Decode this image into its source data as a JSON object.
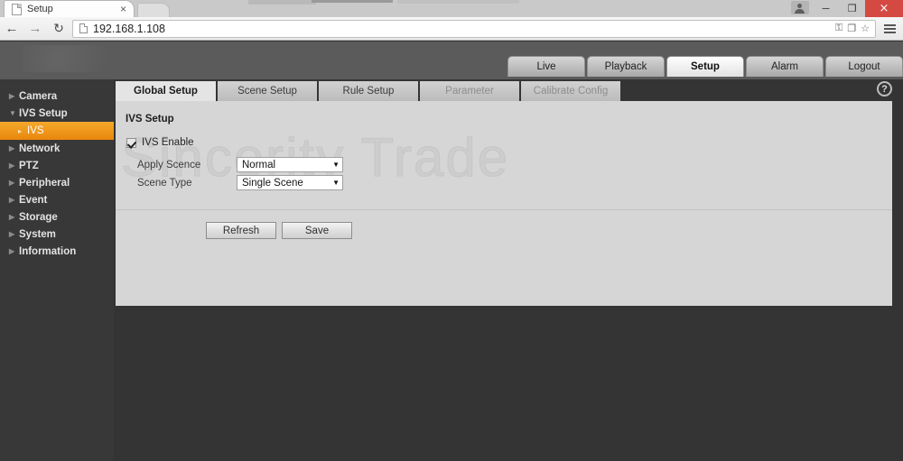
{
  "browser": {
    "tab": {
      "title": "Setup",
      "close_label": "×",
      "favicon": "page-icon"
    },
    "nav": {
      "back": "←",
      "forward": "→",
      "reload": "↻",
      "url": "192.168.1.108",
      "key_icon": "⚿",
      "translate_icon": "❐",
      "star_icon": "☆"
    },
    "window": {
      "minimize": "─",
      "maximize": "❐",
      "close": "×"
    }
  },
  "device": {
    "topnav": [
      {
        "label": "Live",
        "active": false
      },
      {
        "label": "Playback",
        "active": false
      },
      {
        "label": "Setup",
        "active": true
      },
      {
        "label": "Alarm",
        "active": false
      },
      {
        "label": "Logout",
        "active": false
      }
    ],
    "sidebar": [
      {
        "label": "Camera",
        "type": "group",
        "expanded": false
      },
      {
        "label": "IVS Setup",
        "type": "group",
        "expanded": true
      },
      {
        "label": "IVS",
        "type": "sub",
        "active": true
      },
      {
        "label": "Network",
        "type": "group",
        "expanded": false
      },
      {
        "label": "PTZ",
        "type": "group",
        "expanded": false
      },
      {
        "label": "Peripheral",
        "type": "group",
        "expanded": false
      },
      {
        "label": "Event",
        "type": "group",
        "expanded": false
      },
      {
        "label": "Storage",
        "type": "group",
        "expanded": false
      },
      {
        "label": "System",
        "type": "group",
        "expanded": false
      },
      {
        "label": "Information",
        "type": "group",
        "expanded": false
      }
    ],
    "content_tabs": [
      {
        "label": "Global Setup",
        "active": true,
        "disabled": false
      },
      {
        "label": "Scene Setup",
        "active": false,
        "disabled": false
      },
      {
        "label": "Rule Setup",
        "active": false,
        "disabled": false
      },
      {
        "label": "Parameter",
        "active": false,
        "disabled": true
      },
      {
        "label": "Calibrate Config",
        "active": false,
        "disabled": true
      }
    ],
    "help_label": "?",
    "form": {
      "section_title": "IVS Setup",
      "enable": {
        "label": "IVS Enable",
        "checked": true
      },
      "apply_scence": {
        "label": "Apply Scence",
        "value": "Normal",
        "caret": "▼"
      },
      "scene_type": {
        "label": "Scene Type",
        "value": "Single Scene",
        "caret": "▼"
      },
      "buttons": {
        "refresh": "Refresh",
        "save": "Save"
      }
    },
    "watermark": "Sincerity Trade"
  },
  "colors": {
    "accent_orange": "#e8870d",
    "panel_bg": "#d6d6d6",
    "sidebar_bg": "#383838",
    "header_bg": "#5b5b5b",
    "close_red": "#d44a42"
  }
}
